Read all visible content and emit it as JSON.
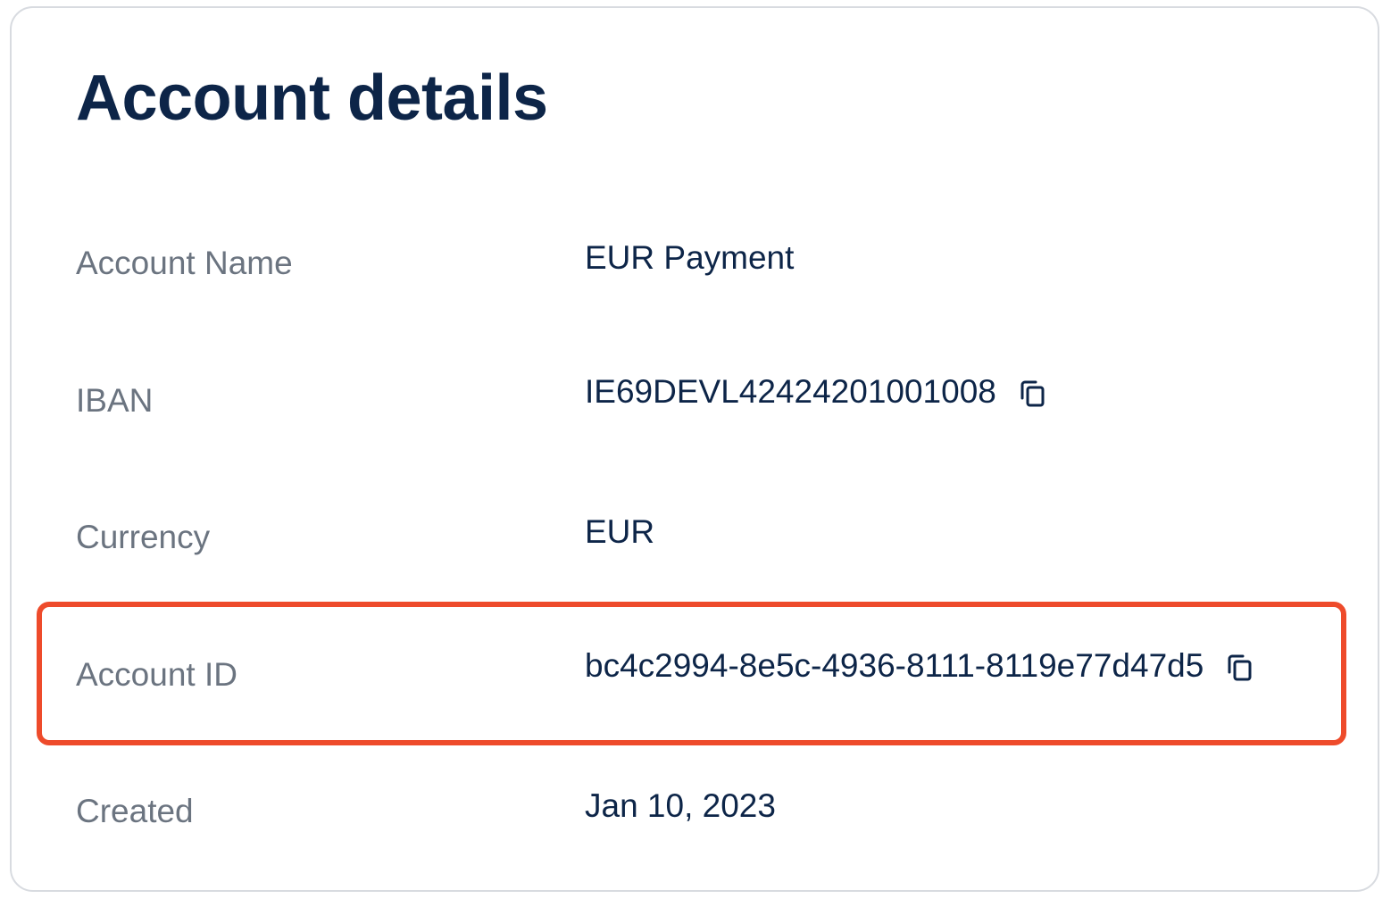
{
  "page": {
    "title": "Account details"
  },
  "details": [
    {
      "label": "Account Name",
      "value": "EUR Payment",
      "copyable": false
    },
    {
      "label": "IBAN",
      "value": "IE69DEVL42424201001008",
      "copyable": true
    },
    {
      "label": "Currency",
      "value": "EUR",
      "copyable": false
    },
    {
      "label": "Account ID",
      "value": "bc4c2994-8e5c-4936-8111-8119e77d47d5",
      "copyable": true,
      "highlighted": true
    },
    {
      "label": "Created",
      "value": "Jan 10, 2023",
      "copyable": false
    }
  ],
  "icons": {
    "copy": "copy-icon"
  },
  "colors": {
    "title": "#0d2548",
    "label": "#6b7480",
    "value": "#0d2548",
    "highlight": "#ee4b2b",
    "card_border": "#d8dbe0"
  }
}
